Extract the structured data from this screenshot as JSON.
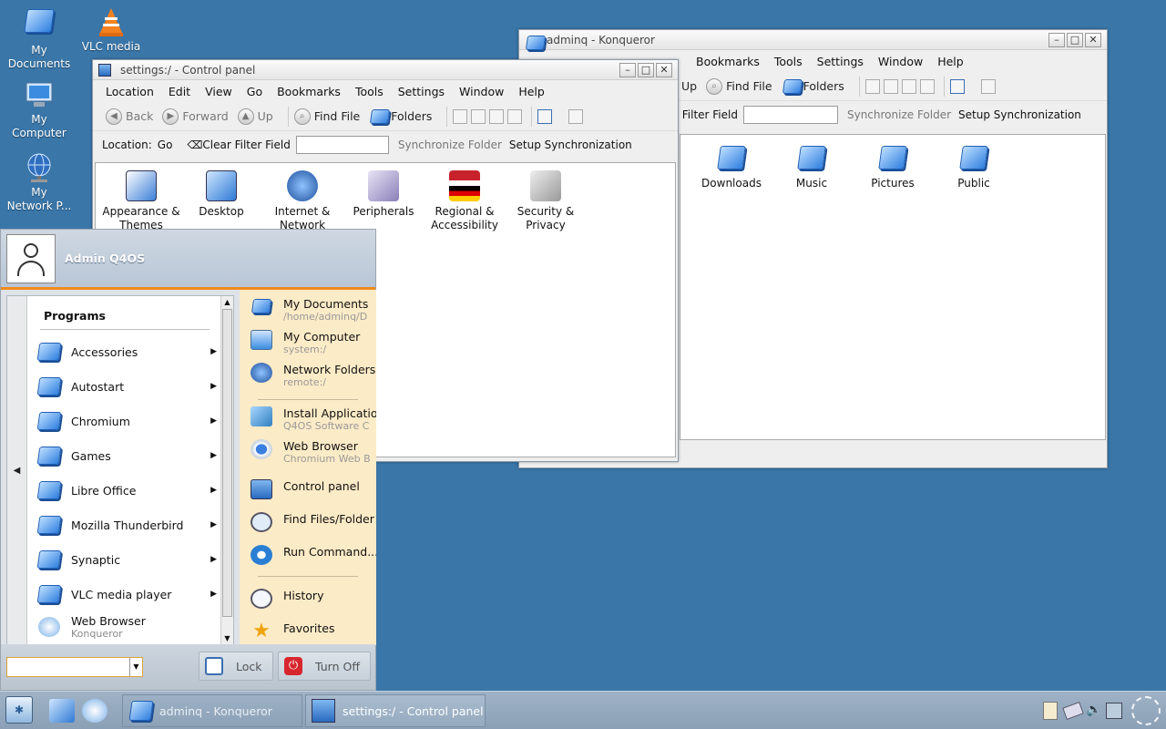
{
  "desktop": {
    "icons": [
      {
        "label": "My\nDocuments"
      },
      {
        "label": "VLC media"
      },
      {
        "label": "My\nComputer"
      },
      {
        "label": "My\nNetwork P..."
      }
    ]
  },
  "konqueror_home": {
    "title": "adminq - Konqueror",
    "menu": [
      "Bookmarks",
      "Tools",
      "Settings",
      "Window",
      "Help"
    ],
    "toolbar": {
      "up": "Up",
      "find": "Find File",
      "folders": "Folders"
    },
    "filterbar": {
      "clear_filter": "r Filter Field",
      "sync": "Synchronize Folder",
      "setup_sync": "Setup Synchronization"
    },
    "folders": [
      "Downloads",
      "Music",
      "Pictures",
      "Public"
    ]
  },
  "control_panel": {
    "title": "settings:/ - Control panel",
    "menu": [
      "Location",
      "Edit",
      "View",
      "Go",
      "Bookmarks",
      "Tools",
      "Settings",
      "Window",
      "Help"
    ],
    "toolbar": {
      "back": "Back",
      "forward": "Forward",
      "up": "Up",
      "find": "Find File",
      "folders": "Folders"
    },
    "locbar": {
      "label": "Location:",
      "go": "Go",
      "clear_filter": "Clear Filter Field",
      "filter_value": "",
      "sync": "Synchronize Folder",
      "setup_sync": "Setup Synchronization"
    },
    "items": [
      {
        "label": "Appearance &\nThemes"
      },
      {
        "label": "Desktop"
      },
      {
        "label": "Internet &\nNetwork"
      },
      {
        "label": "Peripherals"
      },
      {
        "label": "Regional &\nAccessibility"
      },
      {
        "label": "Security &\nPrivacy"
      }
    ]
  },
  "start_menu": {
    "user": "Admin Q4OS",
    "programs_title": "Programs",
    "programs": [
      {
        "label": "Accessories"
      },
      {
        "label": "Autostart"
      },
      {
        "label": "Chromium"
      },
      {
        "label": "Games"
      },
      {
        "label": "Libre Office"
      },
      {
        "label": "Mozilla Thunderbird"
      },
      {
        "label": "Synaptic"
      },
      {
        "label": "VLC media player"
      }
    ],
    "last_program": {
      "label": "Web Browser",
      "sub": "Konqueror"
    },
    "right": {
      "my_documents": {
        "label": "My Documents",
        "sub": "/home/adminq/D"
      },
      "my_computer": {
        "label": "My Computer",
        "sub": "system:/"
      },
      "network": {
        "label": "Network Folders",
        "sub": "remote:/"
      },
      "install": {
        "label": "Install Applicatio",
        "sub": "Q4OS Software C"
      },
      "browser": {
        "label": "Web Browser",
        "sub": "Chromium Web B"
      },
      "control_panel": {
        "label": "Control panel"
      },
      "find": {
        "label": "Find Files/Folder"
      },
      "run": {
        "label": "Run Command..."
      },
      "history": {
        "label": "History"
      },
      "favorites": {
        "label": "Favorites"
      }
    },
    "search_value": "",
    "lock": "Lock",
    "turn_off": "Turn Off"
  },
  "taskbar": {
    "task1": "adminq - Konqueror",
    "task2": "settings:/ - Control panel"
  }
}
